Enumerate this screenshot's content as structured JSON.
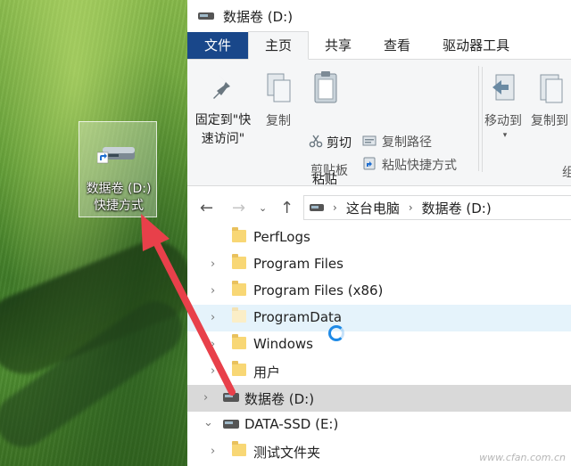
{
  "desktop": {
    "shortcut_label_line1": "数据卷 (D:)",
    "shortcut_label_line2": "快捷方式",
    "shortcut_icon": "drive-shortcut-icon"
  },
  "window": {
    "title": "数据卷 (D:)"
  },
  "tabs": [
    {
      "label": "文件"
    },
    {
      "label": "主页"
    },
    {
      "label": "共享"
    },
    {
      "label": "查看"
    },
    {
      "label": "驱动器工具"
    }
  ],
  "ribbon": {
    "pin_label_line1": "固定到\"快",
    "pin_label_line2": "速访问\"",
    "copy_label": "复制",
    "paste_label": "粘贴",
    "copy_path_label": "复制路径",
    "paste_shortcut_label": "粘贴快捷方式",
    "cut_label": "剪切",
    "clipboard_group": "剪贴板",
    "move_to_label": "移动到",
    "copy_to_label": "复制到",
    "partial_group_char": "组"
  },
  "address": {
    "crumbs": [
      "这台电脑",
      "数据卷 (D:)"
    ]
  },
  "tree": [
    {
      "label": "PerfLogs"
    },
    {
      "label": "Program Files"
    },
    {
      "label": "Program Files (x86)"
    },
    {
      "label": "ProgramData"
    },
    {
      "label": "Windows"
    },
    {
      "label": "用户"
    },
    {
      "label": "数据卷 (D:)"
    },
    {
      "label": "DATA-SSD (E:)"
    },
    {
      "label": "测试文件夹"
    }
  ],
  "watermark": "www.cfan.com.cn",
  "colors": {
    "file_tab": "#19478a",
    "arrow": "#e8404a",
    "busy": "#1e8ae6"
  }
}
